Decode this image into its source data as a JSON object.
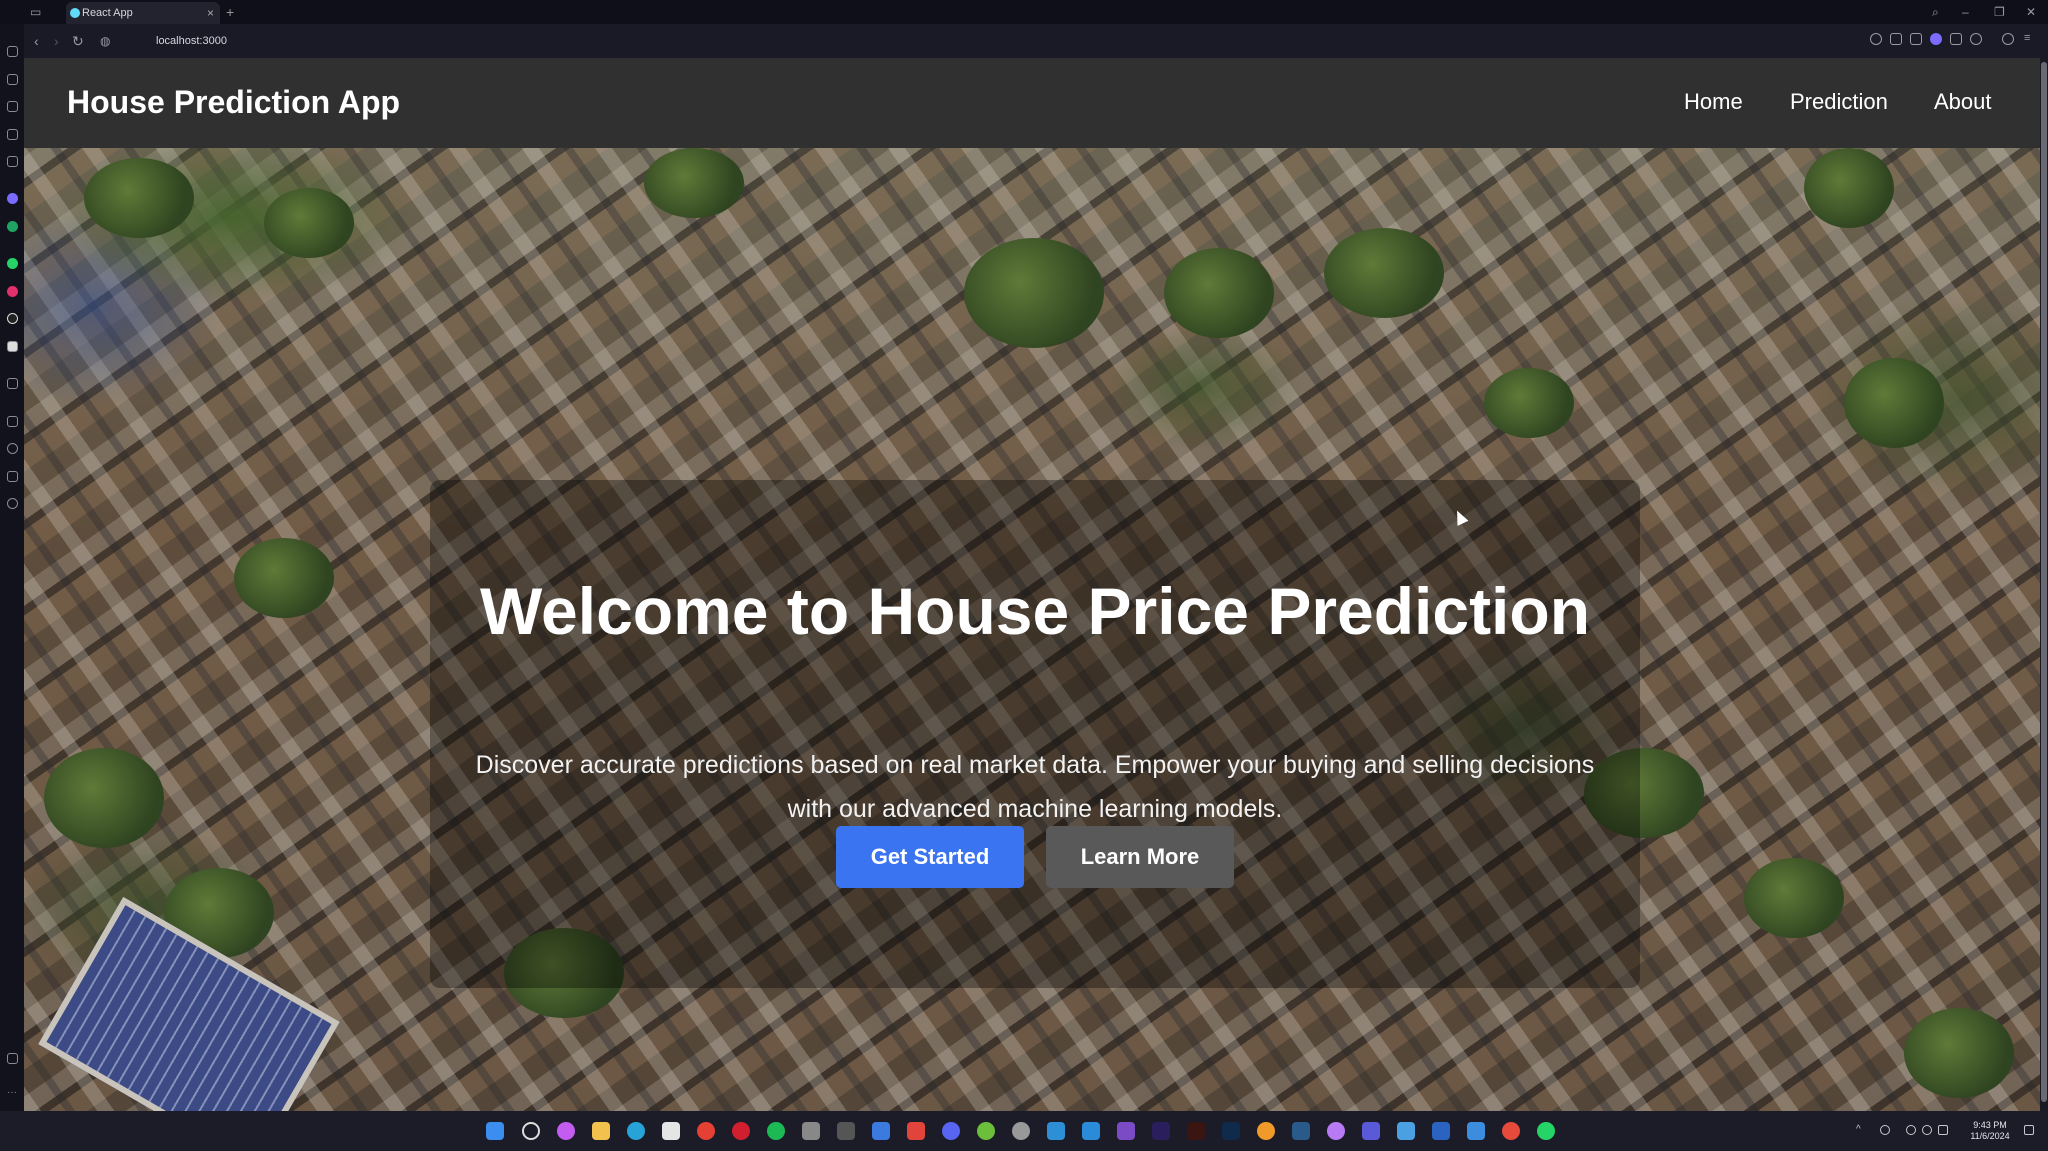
{
  "browser": {
    "tab_title": "React App",
    "tab_close": "×",
    "new_tab": "+",
    "url": "localhost:3000"
  },
  "app": {
    "title": "House Prediction App",
    "nav": [
      {
        "label": "Home"
      },
      {
        "label": "Prediction"
      },
      {
        "label": "About"
      }
    ]
  },
  "hero": {
    "title": "Welcome to House Price Prediction",
    "subtitle": "Discover accurate predictions based on real market data. Empower your buying and selling decisions with our advanced machine learning models.",
    "primary_button": "Get Started",
    "secondary_button": "Learn More"
  },
  "taskbar": {
    "time": "9:43 PM",
    "date": "11/6/2024"
  },
  "colors": {
    "header_bg": "#303030",
    "primary_button": "#3b74f0",
    "secondary_button": "#595959"
  }
}
